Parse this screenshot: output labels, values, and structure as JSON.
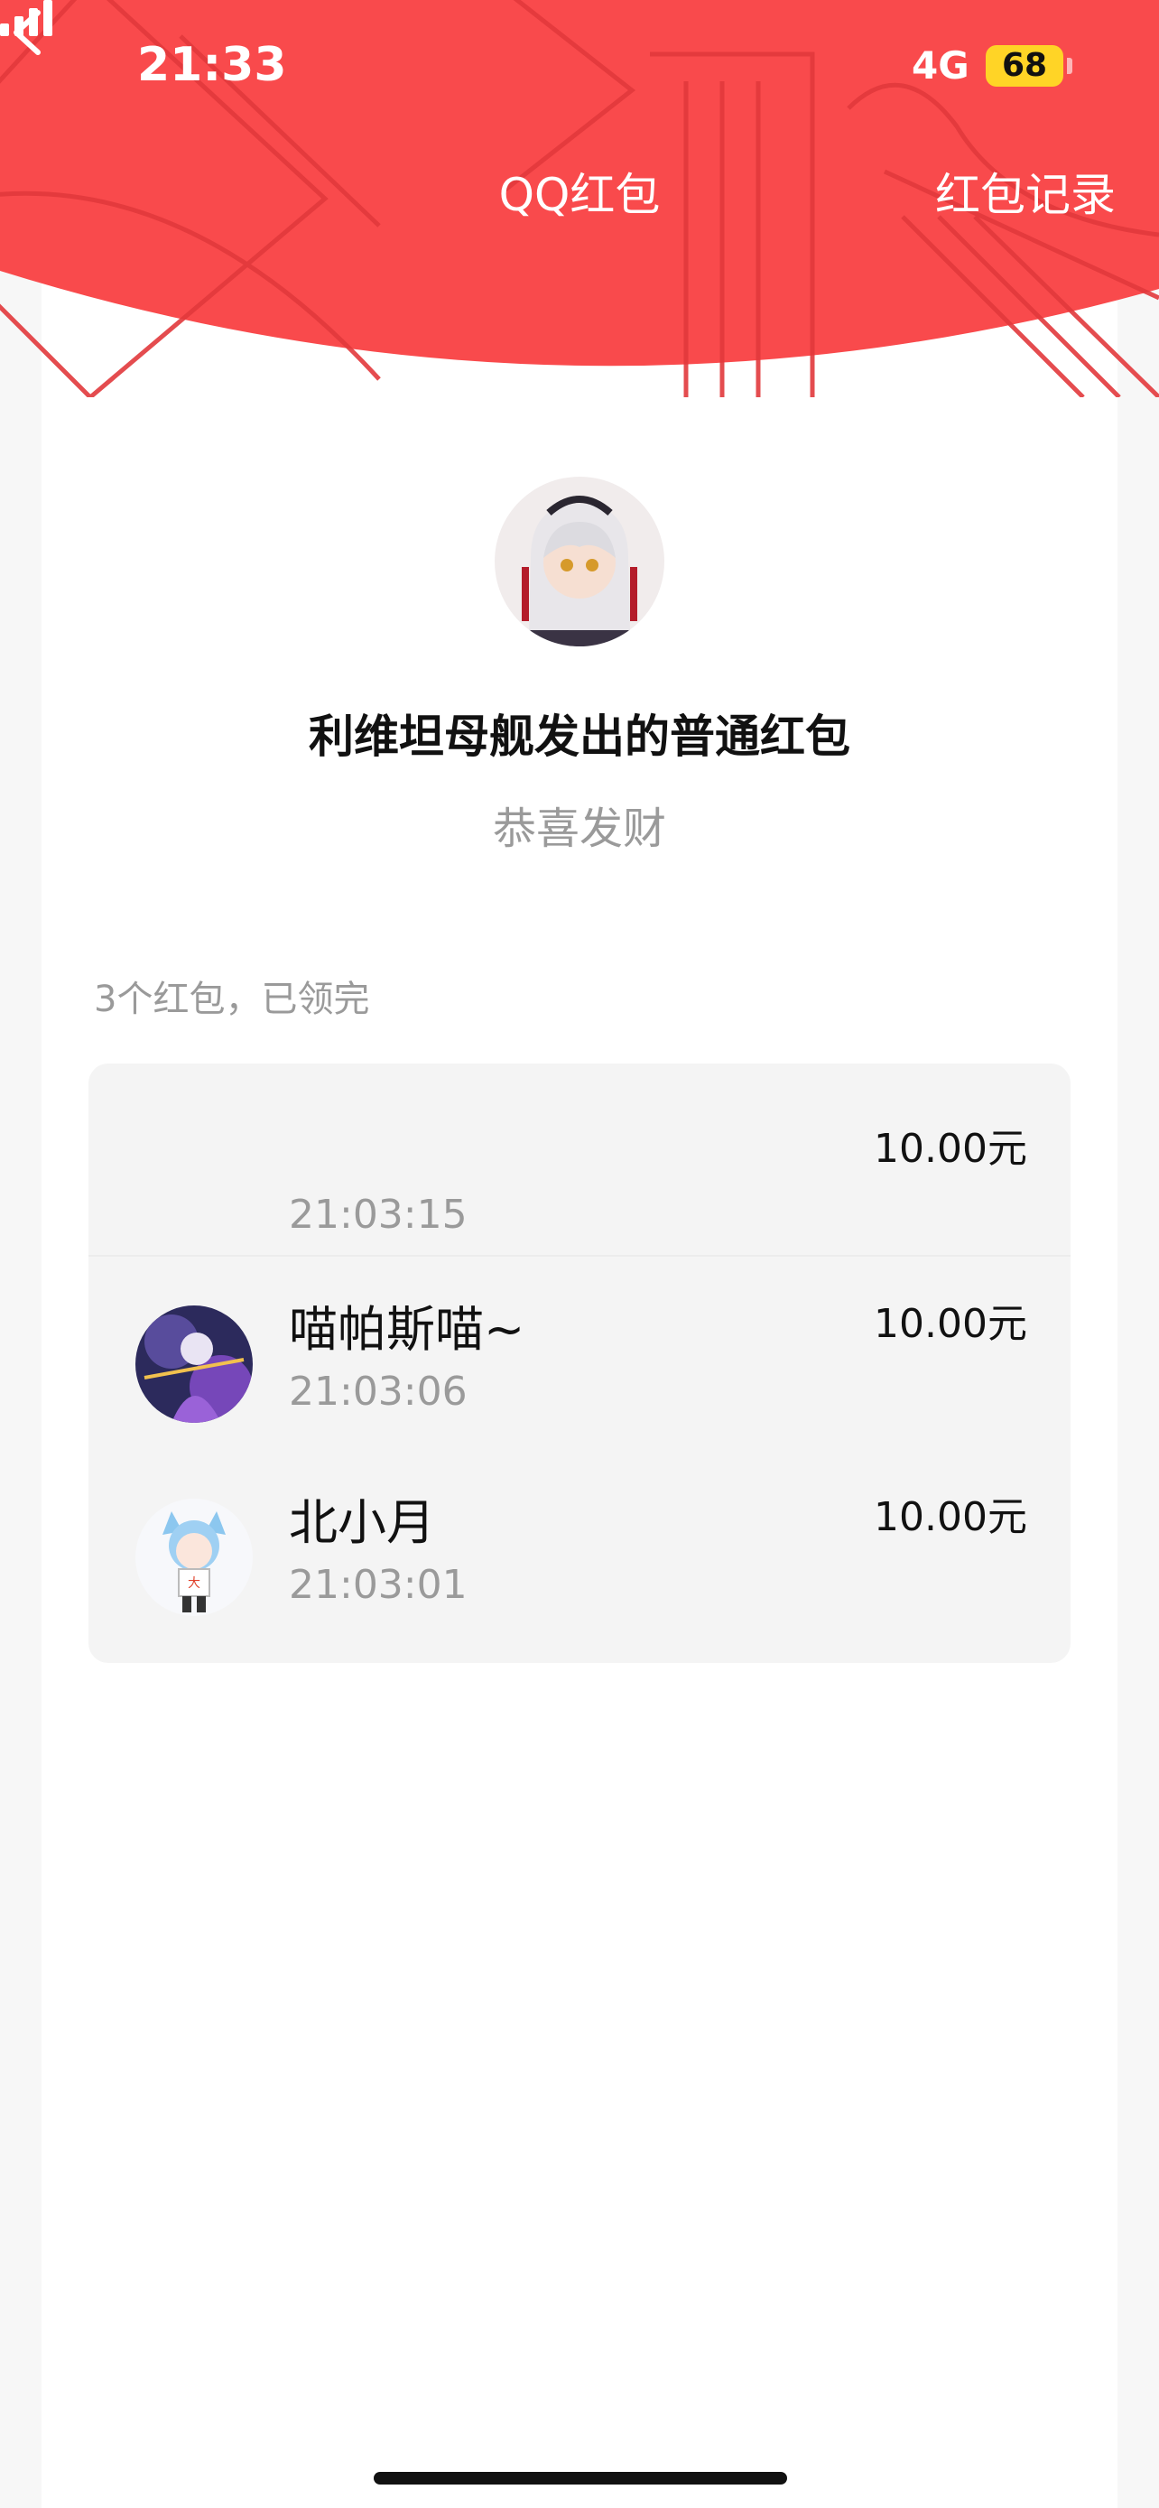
{
  "status_bar": {
    "time": "21:33",
    "network": "4G",
    "battery": "68"
  },
  "nav": {
    "title": "QQ红包",
    "record": "红包记录"
  },
  "sender": {
    "title": "利维坦母舰发出的普通红包",
    "greeting": "恭喜发财"
  },
  "summary": "3个红包，已领完",
  "recipients": [
    {
      "name": "",
      "time": "21:03:15",
      "amount": "10.00元"
    },
    {
      "name": "喵帕斯喵~",
      "time": "21:03:06",
      "amount": "10.00元"
    },
    {
      "name": "北小月",
      "time": "21:03:01",
      "amount": "10.00元"
    }
  ],
  "colors": {
    "header_red": "#f94a4c",
    "pattern": "#e53a3d"
  }
}
